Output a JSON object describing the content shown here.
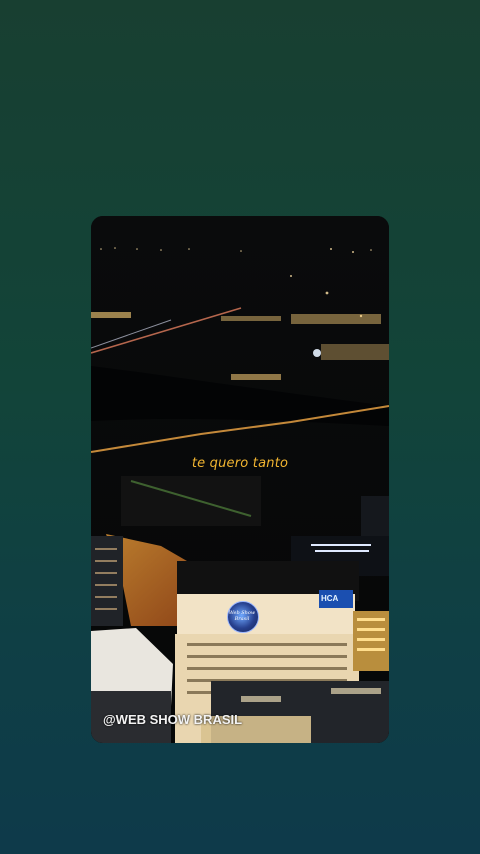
{
  "video": {
    "lyric_text": "te quero tanto",
    "watermark_text": "@WEB SHOW BRASIL",
    "building_sign": "HCA",
    "logo_lettering": "Web Show Brasil"
  },
  "colors": {
    "lyric": "#f2b531",
    "background_top": "#183f31",
    "background_bottom": "#0e3a4a"
  }
}
